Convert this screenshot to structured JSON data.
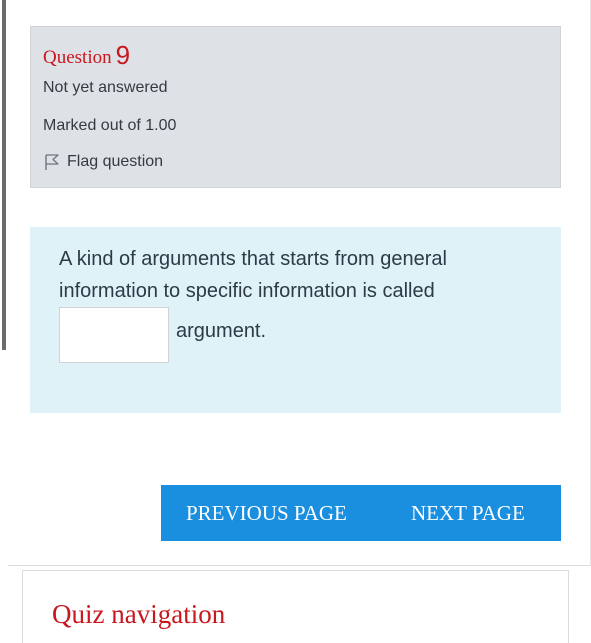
{
  "question_info": {
    "label": "Question",
    "number": "9",
    "status": "Not yet answered",
    "marks": "Marked out of 1.00",
    "flag_label": "Flag question"
  },
  "question": {
    "text": "A kind of arguments that starts from general information to specific information is called",
    "answer_value": "",
    "suffix": "argument."
  },
  "navigation": {
    "previous_label": "PREVIOUS PAGE",
    "next_label": "NEXT PAGE"
  },
  "quiz_nav": {
    "title": "Quiz navigation"
  },
  "colors": {
    "accent_red": "#c8171e",
    "button_blue": "#1a8fe0",
    "info_bg": "#dee2e6",
    "question_bg": "#def2f8"
  }
}
